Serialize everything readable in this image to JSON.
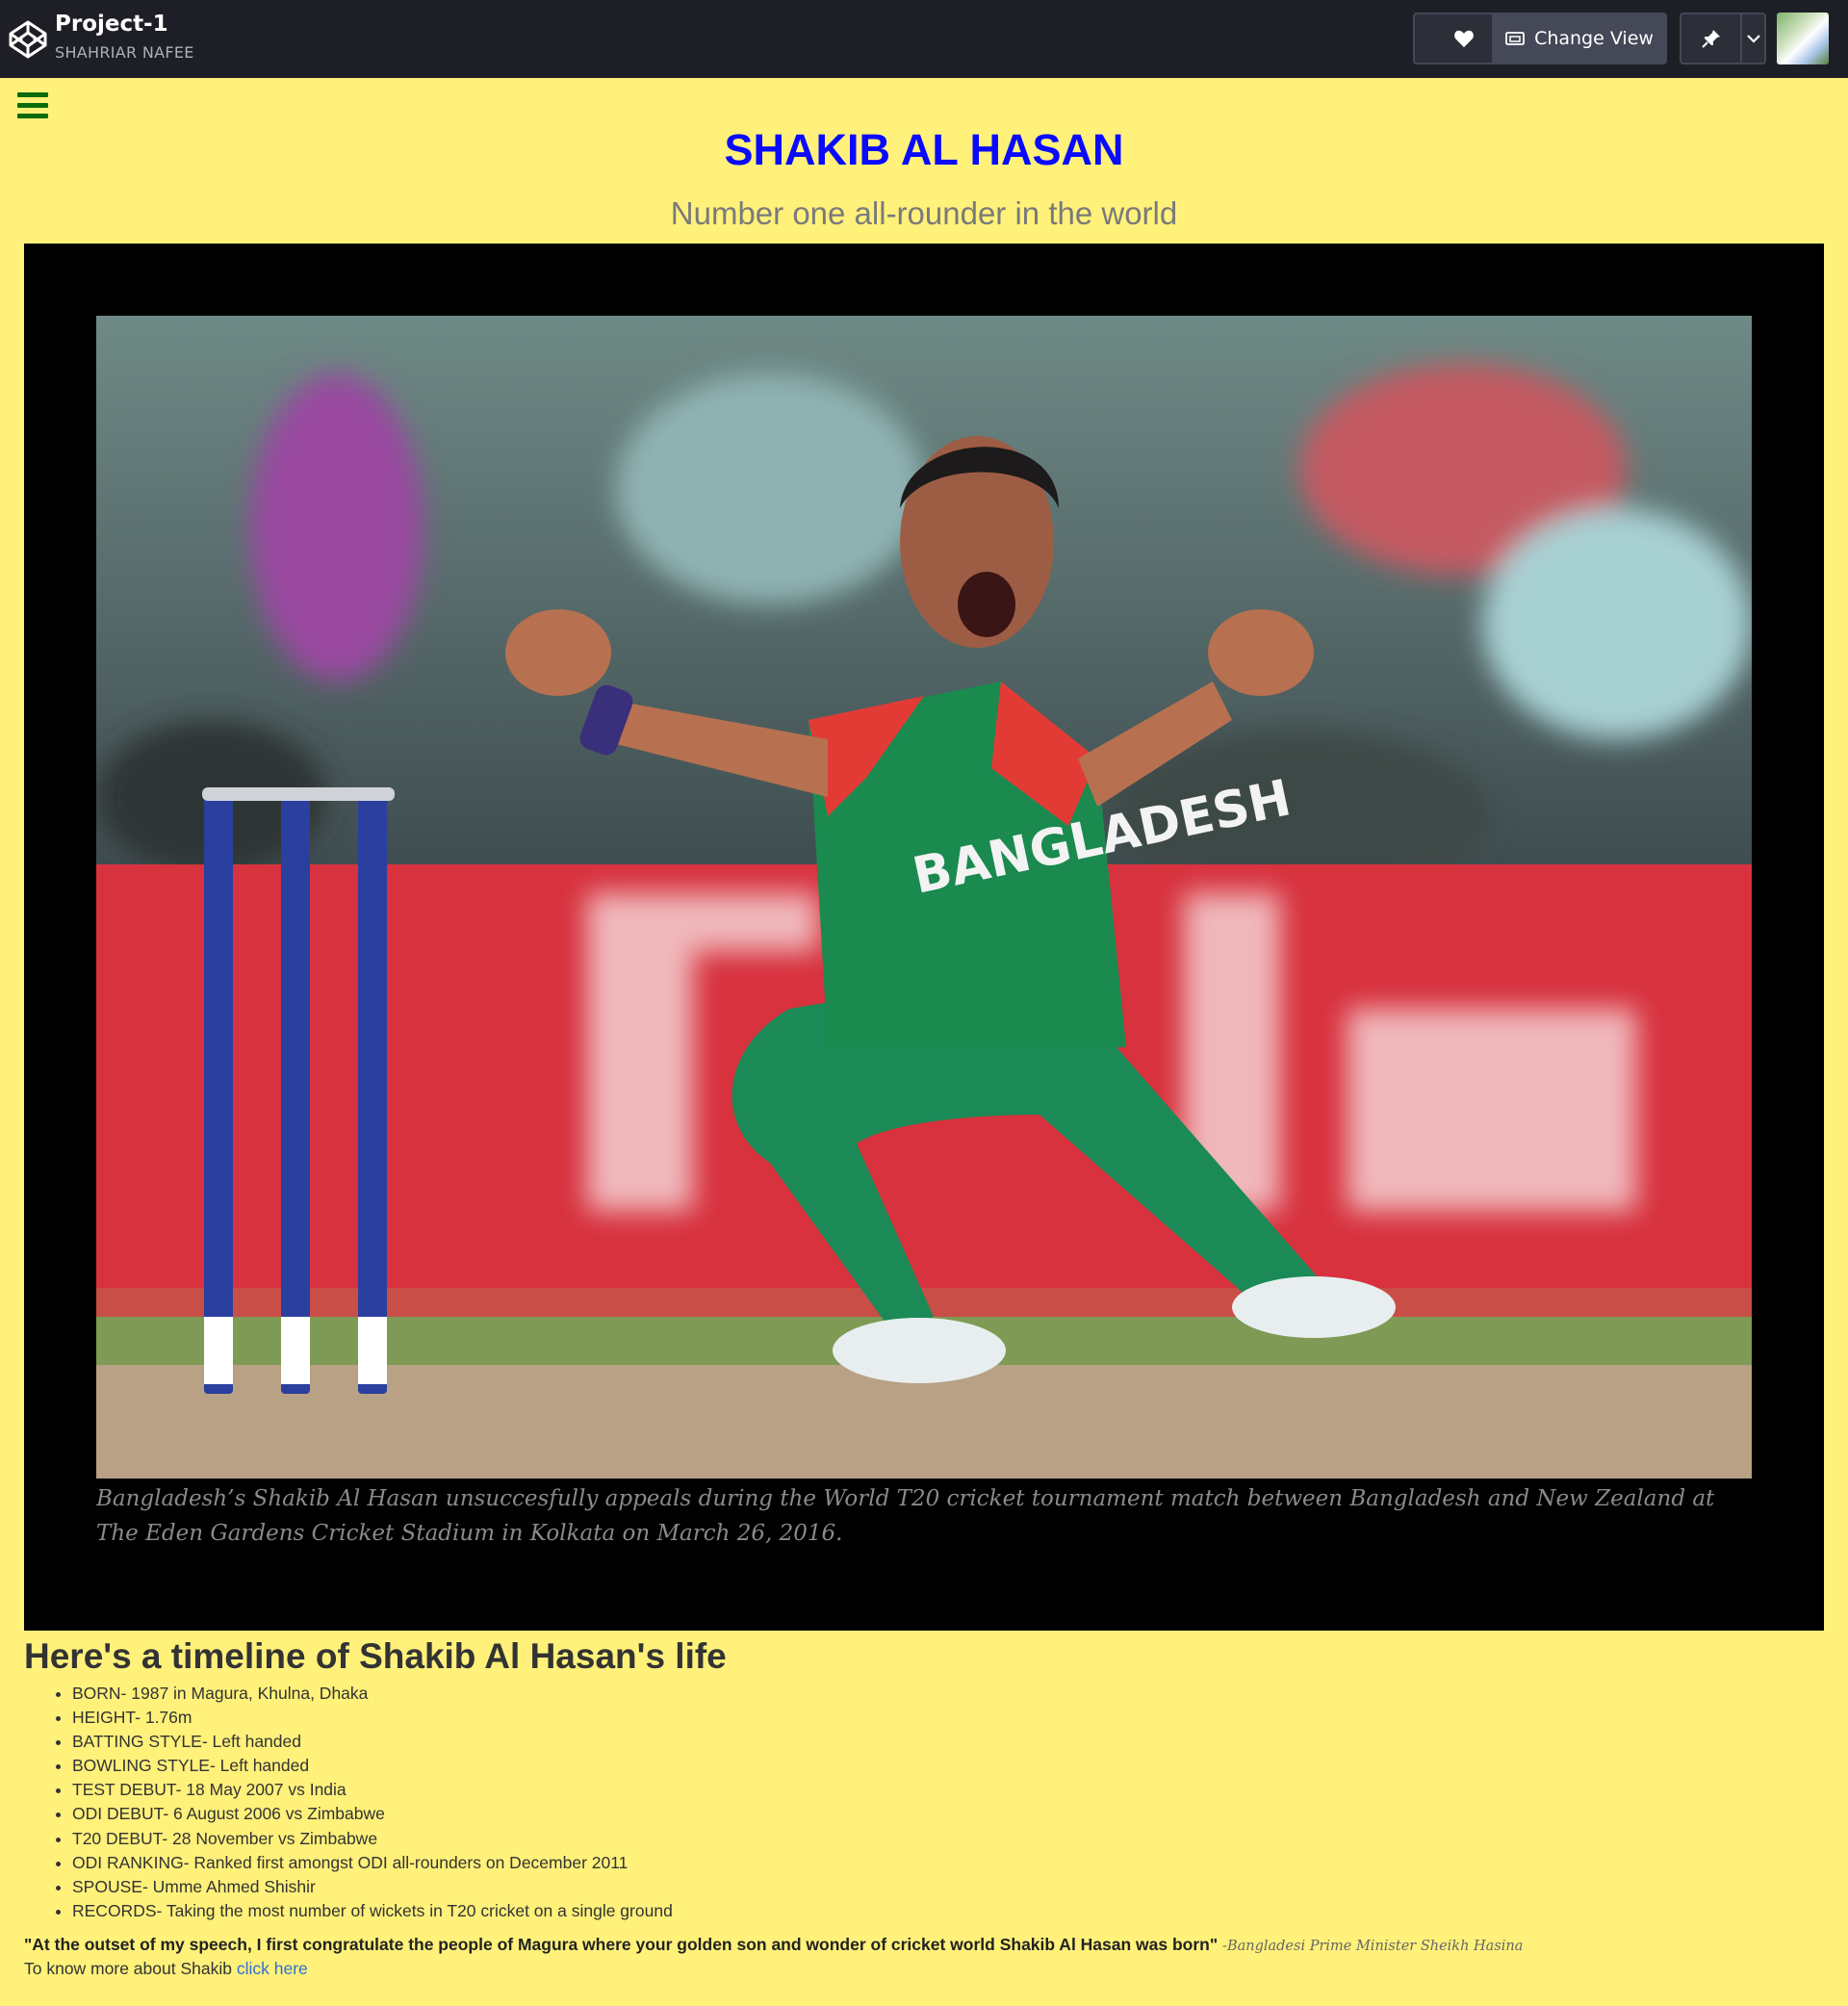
{
  "header": {
    "project_title": "Project-1",
    "author": "SHAHRIAR NAFEE",
    "change_view_label": "Change View",
    "icons": [
      "codepen-logo-icon",
      "heart-icon",
      "change-view-icon",
      "pin-icon",
      "chevron-down-icon"
    ]
  },
  "page": {
    "title": "SHAKIB AL HASAN",
    "subtitle": "Number one all-rounder in the world",
    "image_caption": "Bangladesh’s Shakib Al Hasan unsuccesfully appeals during the World T20 cricket tournament match between Bangladesh and New Zealand at The Eden Gardens Cricket Stadium in Kolkata on March 26, 2016.",
    "timeline_heading": "Here's a timeline of Shakib Al Hasan's life",
    "facts": [
      "BORN- 1987 in Magura, Khulna, Dhaka",
      "HEIGHT- 1.76m",
      "BATTING STYLE- Left handed",
      "BOWLING STYLE- Left handed",
      "TEST DEBUT- 18 May 2007 vs India",
      "ODI DEBUT- 6 August 2006 vs Zimbabwe",
      "T20 DEBUT- 28 November vs Zimbabwe",
      "ODI RANKING- Ranked first amongst ODI all-rounders on December 2011",
      "SPOUSE- Umme Ahmed Shishir",
      "RECORDS- Taking the most number of wickets in T20 cricket on a single ground"
    ],
    "quote": "\"At the outset of my speech, I first congratulate the people of Magura where your golden son and wonder of cricket world Shakib Al Hasan was born\"",
    "quote_attribution": "-Bangladesi Prime Minister Sheikh Hasina",
    "more_text": "To know more about Shakib",
    "more_link": "click here"
  },
  "colors": {
    "page_background": "#fff17a",
    "title": "#0a0aff",
    "topbar": "#1e1f26",
    "link": "#2f6fd6"
  }
}
